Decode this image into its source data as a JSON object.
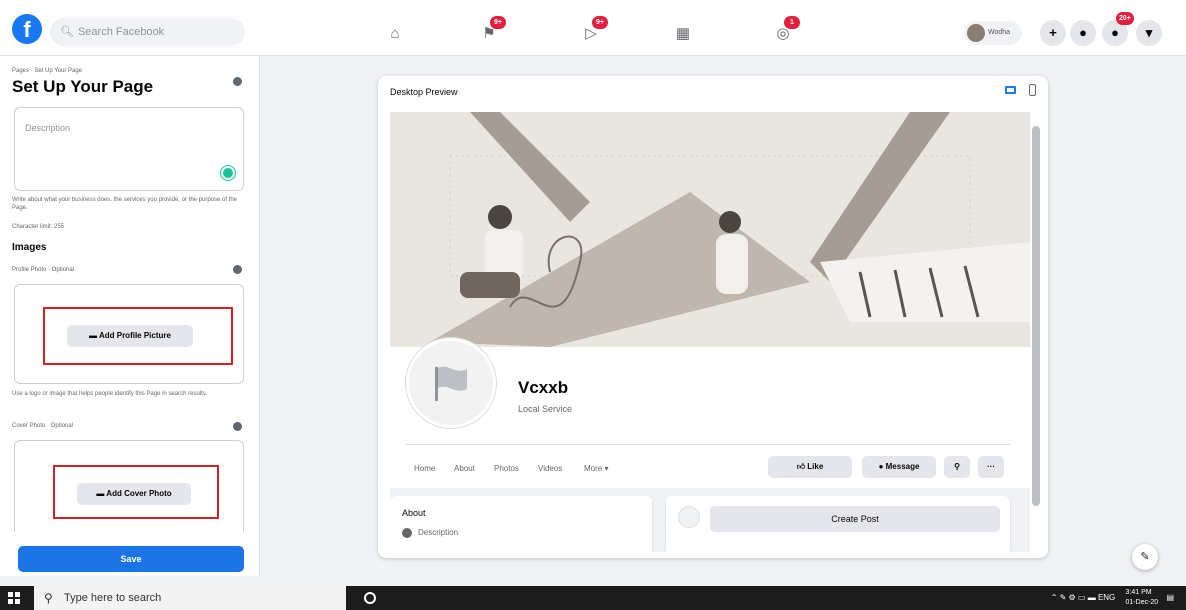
{
  "topbar": {
    "logo": "f",
    "search_placeholder": "Search Facebook",
    "nav": [
      {
        "icon": "home-icon",
        "glyph": "⌂",
        "badge": ""
      },
      {
        "icon": "flag-icon",
        "glyph": "⚑",
        "badge": "9+"
      },
      {
        "icon": "watch-icon",
        "glyph": "▷",
        "badge": "9+"
      },
      {
        "icon": "marketplace-icon",
        "glyph": "▦",
        "badge": ""
      },
      {
        "icon": "groups-icon",
        "glyph": "◎",
        "badge": "1"
      }
    ],
    "profile_name": "Wodha",
    "create_glyph": "+",
    "messenger_glyph": "●",
    "notifications_glyph": "●",
    "notifications_badge": "20+",
    "account_glyph": "▾"
  },
  "left": {
    "breadcrumb": "Pages · Set Up Your Page",
    "title": "Set Up Your Page",
    "description_placeholder": "Description",
    "description_help": "Write about what your business does, the services you provide, or the purpose of the Page.",
    "char_limit": "Character limit: 255",
    "images_heading": "Images",
    "profile_photo_label": "Profile Photo · Optional",
    "add_profile_picture": "Add Profile Picture",
    "profile_help": "Use a logo or image that helps people identify this Page in search results.",
    "cover_photo_label": "Cover Photo · Optional",
    "add_cover_photo": "Add Cover Photo",
    "save": "Save"
  },
  "preview": {
    "label": "Desktop Preview",
    "page_name": "Vcxxb",
    "category": "Local Service",
    "tabs": [
      "Home",
      "About",
      "Photos",
      "Videos",
      "More ▾"
    ],
    "like": "Like",
    "message": "Message",
    "about_heading": "About",
    "about_description": "Description",
    "create_post": "Create Post"
  },
  "taskbar": {
    "search_placeholder": "Type here to search",
    "lang": "ENG",
    "time": "3:41 PM",
    "date": "01-Dec-20"
  },
  "colors": {
    "brand_blue": "#1877f2",
    "save_blue": "#1b74e4",
    "highlight_red": "#d42026",
    "badge_red": "#e41e3f"
  }
}
